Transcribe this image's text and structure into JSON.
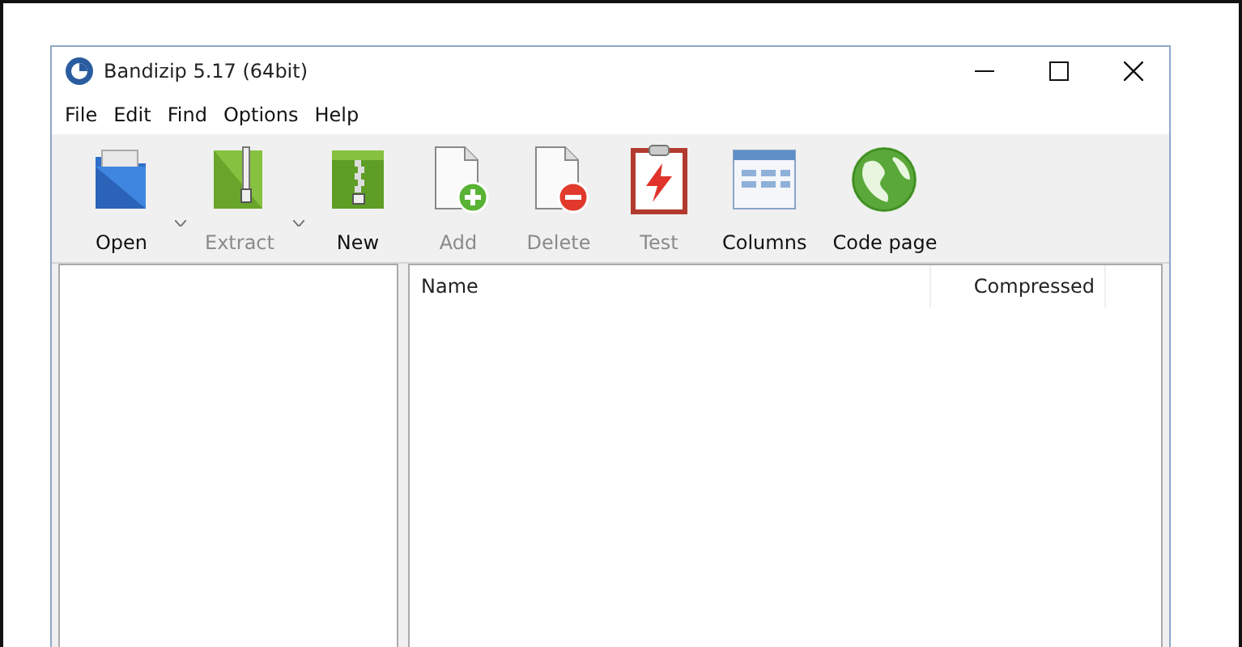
{
  "window": {
    "title": "Bandizip 5.17 (64bit)"
  },
  "menu": [
    "File",
    "Edit",
    "Find",
    "Options",
    "Help"
  ],
  "toolbar": [
    {
      "kind": "open",
      "label": "Open",
      "disabled": false,
      "dropdown": true
    },
    {
      "kind": "extract",
      "label": "Extract",
      "disabled": true,
      "dropdown": true
    },
    {
      "kind": "new",
      "label": "New",
      "disabled": false,
      "dropdown": false
    },
    {
      "kind": "add",
      "label": "Add",
      "disabled": true,
      "dropdown": false
    },
    {
      "kind": "delete",
      "label": "Delete",
      "disabled": true,
      "dropdown": false
    },
    {
      "kind": "test",
      "label": "Test",
      "disabled": true,
      "dropdown": false
    },
    {
      "kind": "columns",
      "label": "Columns",
      "disabled": false,
      "dropdown": false
    },
    {
      "kind": "codepage",
      "label": "Code page",
      "disabled": false,
      "dropdown": false
    }
  ],
  "file_list": {
    "columns": [
      "Name",
      "Compressed"
    ]
  }
}
